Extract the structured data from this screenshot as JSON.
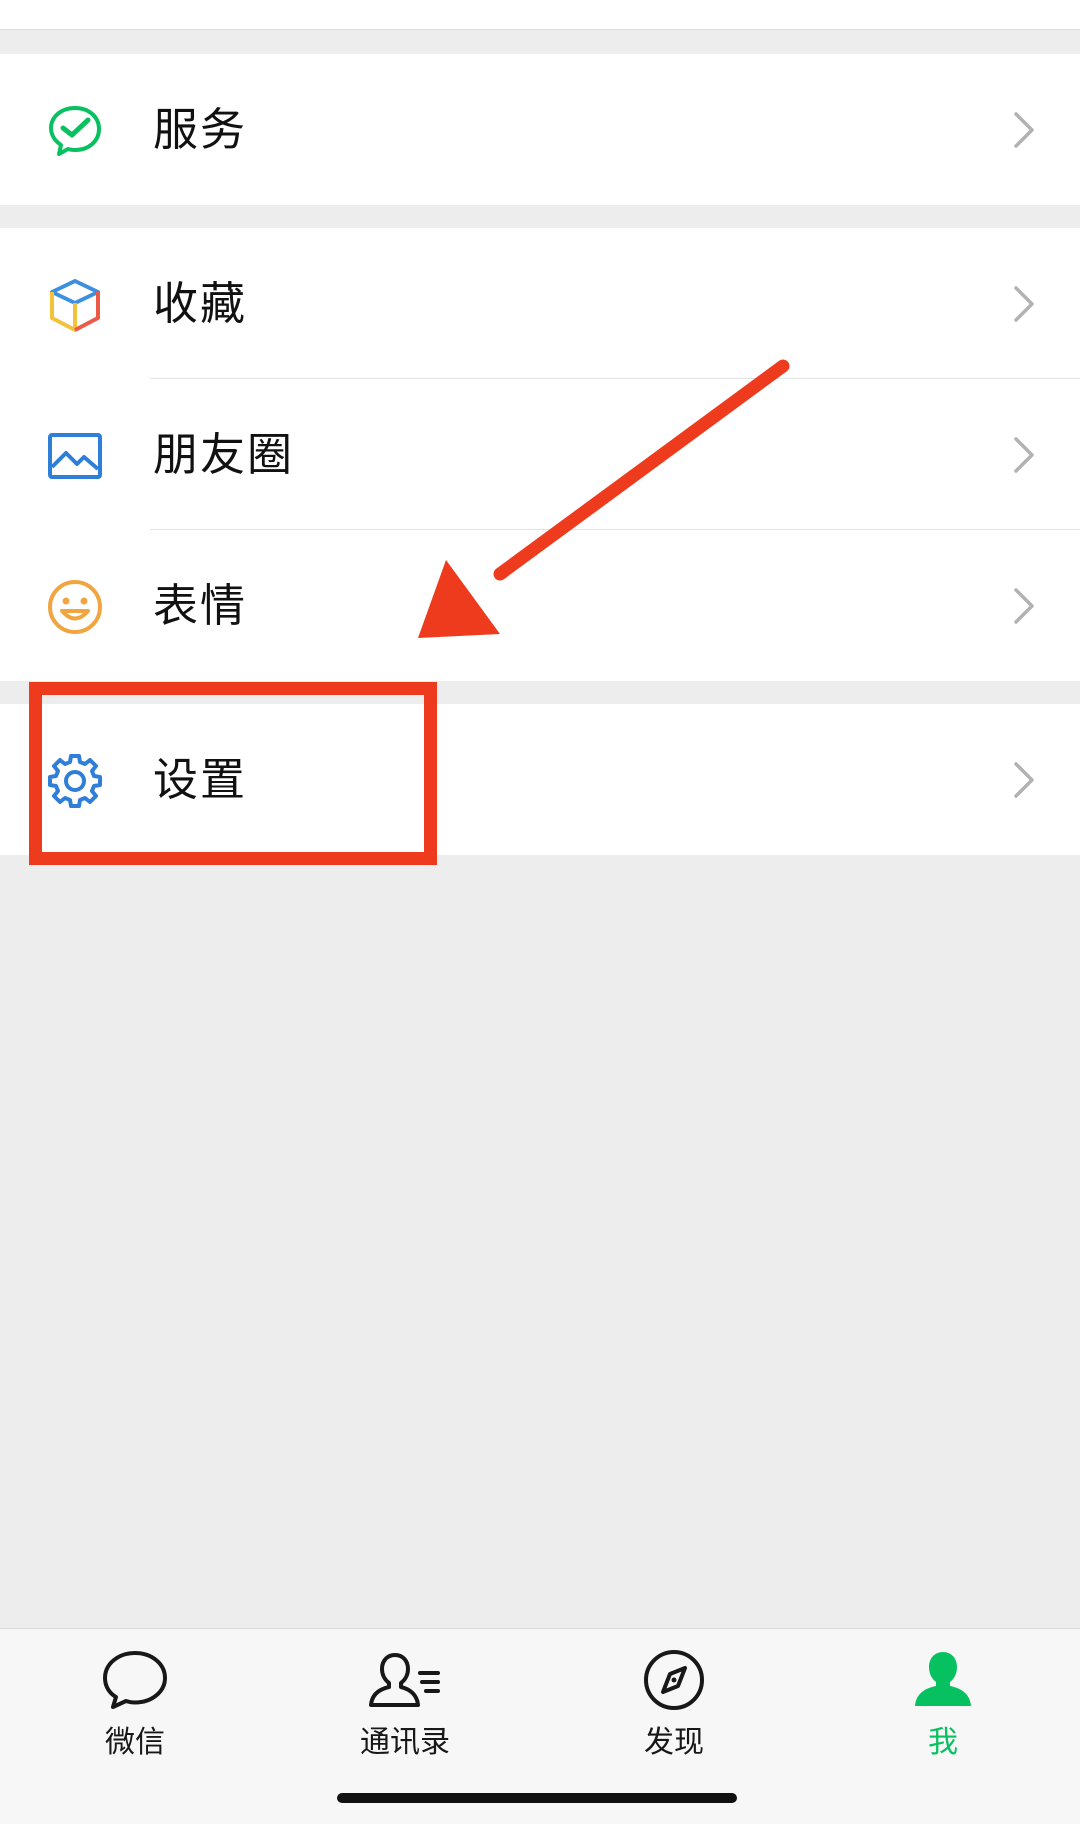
{
  "menu": {
    "services": {
      "label": "服务",
      "icon": "wechat-pay-icon"
    },
    "favorites": {
      "label": "收藏",
      "icon": "cube-icon"
    },
    "moments": {
      "label": "朋友圈",
      "icon": "picture-icon"
    },
    "stickers": {
      "label": "表情",
      "icon": "smiley-icon"
    },
    "settings": {
      "label": "设置",
      "icon": "gear-icon"
    }
  },
  "tabbar": {
    "tabs": [
      {
        "label": "微信",
        "icon": "chat-bubble-icon"
      },
      {
        "label": "通讯录",
        "icon": "contacts-icon"
      },
      {
        "label": "发现",
        "icon": "compass-icon"
      },
      {
        "label": "我",
        "icon": "person-icon"
      }
    ],
    "active_index": 3
  },
  "colors": {
    "accent": "#07c160",
    "annotation": "#ee3a1d",
    "page_background": "#ededed"
  }
}
